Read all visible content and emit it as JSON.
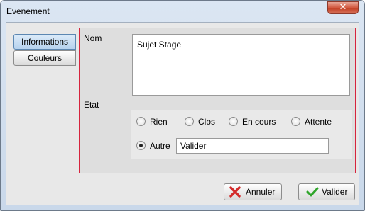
{
  "window": {
    "title": "Evenement",
    "close_glyph": "✕"
  },
  "tabs": [
    {
      "label": "Informations",
      "selected": true
    },
    {
      "label": "Couleurs",
      "selected": false
    }
  ],
  "form": {
    "nom_label": "Nom",
    "nom_value": "Sujet Stage",
    "etat_label": "Etat",
    "etat_options": [
      {
        "label": "Rien",
        "checked": false
      },
      {
        "label": "Clos",
        "checked": false
      },
      {
        "label": "En cours",
        "checked": false
      },
      {
        "label": "Attente",
        "checked": false
      },
      {
        "label": "Autre",
        "checked": true
      }
    ],
    "autre_value": "Valider"
  },
  "buttons": {
    "cancel_label": "Annuler",
    "ok_label": "Valider"
  },
  "icons": {
    "cancel": "x-mark-icon",
    "ok": "check-mark-icon"
  },
  "colors": {
    "panel_border": "#d6243d",
    "cancel_icon": "#d32b2b",
    "ok_icon": "#2fa52a",
    "close_button": "#c8452b"
  }
}
